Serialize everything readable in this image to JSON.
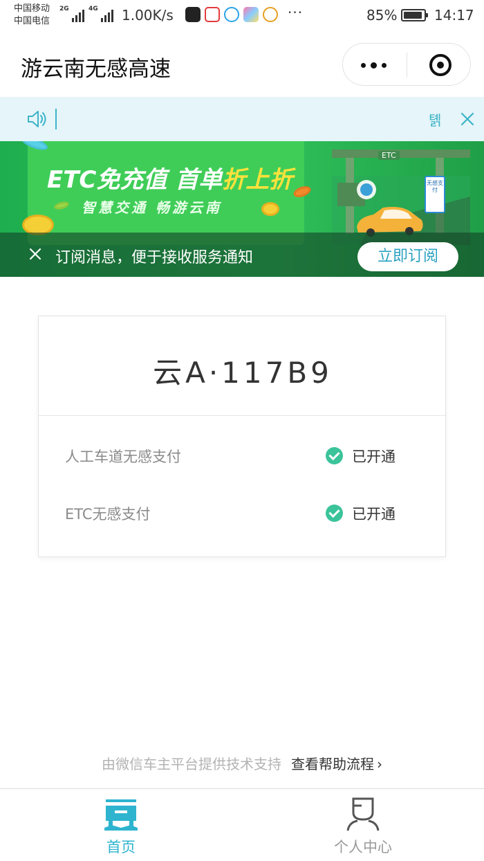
{
  "status_bar": {
    "carrier_1": "中国移动",
    "carrier_2": "中国电信",
    "net_1": "2G",
    "net_2": "4G",
    "net_speed": "1.00K/s",
    "more": "···",
    "battery": "85%",
    "time": "14:17"
  },
  "nav": {
    "title": "游云南无感高速"
  },
  "notice": {
    "text": "",
    "tail": "톍"
  },
  "banner": {
    "headline_a": "ETC免充值 首单",
    "headline_b": "折上折",
    "subline": "智慧交通 畅游云南",
    "etc_tag": "ETC",
    "sign_text": "无感支付",
    "subscribe_text": "订阅消息，便于接收服务通知",
    "subscribe_button": "立即订阅"
  },
  "card": {
    "plate": "云A·117B9",
    "rows": [
      {
        "label": "人工车道无感支付",
        "status": "已开通"
      },
      {
        "label": "ETC无感支付",
        "status": "已开通"
      }
    ]
  },
  "footer": {
    "support_text": "由微信车主平台提供技术支持",
    "help_link": "查看帮助流程",
    "chevron": "›"
  },
  "tabs": [
    {
      "label": "首页",
      "active": true
    },
    {
      "label": "个人中心",
      "active": false
    }
  ],
  "colors": {
    "accent": "#2eb4cf",
    "check": "#3bc39a",
    "banner_green": "#2fc15a",
    "headline_yellow": "#ffe23c",
    "notice_bg": "#e5f5f9"
  }
}
